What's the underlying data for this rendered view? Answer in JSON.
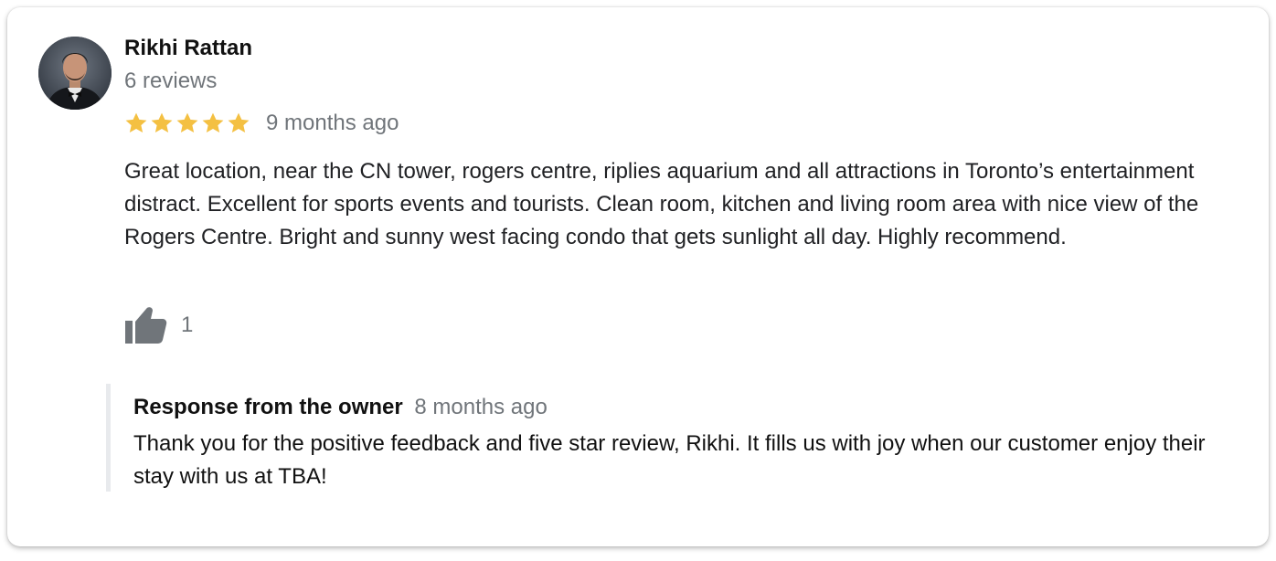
{
  "review": {
    "author": {
      "name": "Rikhi Rattan",
      "review_count": "6 reviews",
      "avatar_icon": "profile-photo"
    },
    "rating": {
      "stars": 5,
      "max_stars": 5,
      "star_color": "#f4c042"
    },
    "time_ago": "9 months ago",
    "text": "Great location, near the CN tower, rogers centre, riplies aquarium and all attractions in Toronto’s entertainment distract. Excellent for sports events and tourists. Clean room, kitchen and living room area with nice view of the Rogers Centre. Bright and sunny west facing condo that gets sunlight all day. Highly recommend.",
    "likes": {
      "icon": "thumbs-up-icon",
      "count": "1"
    }
  },
  "owner_response": {
    "title": "Response from the owner",
    "time_ago": "8 months ago",
    "text": "Thank you for the positive feedback and five star review, Rikhi. It fills us with joy when our customer enjoy their stay with us at TBA!"
  }
}
